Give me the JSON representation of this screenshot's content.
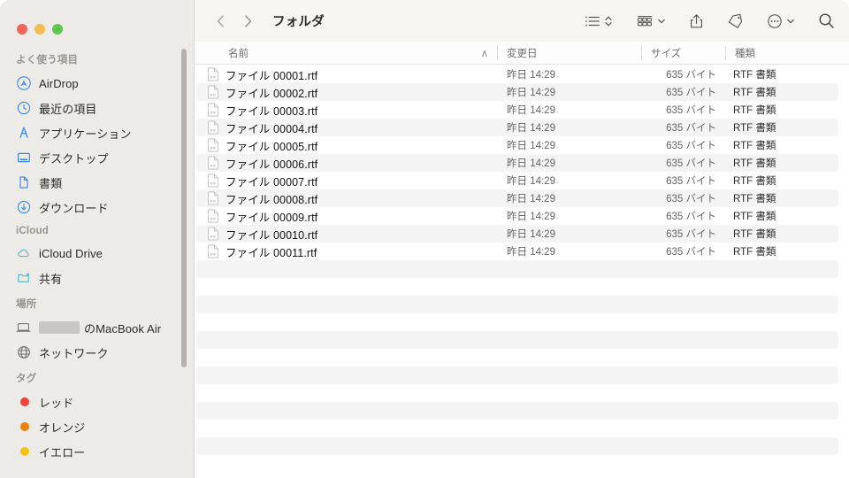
{
  "window": {
    "traffic_lights": [
      {
        "name": "close",
        "color": "#f2655b"
      },
      {
        "name": "minimize",
        "color": "#f4bd4f"
      },
      {
        "name": "maximize",
        "color": "#61c554"
      }
    ]
  },
  "sidebar": {
    "groups": [
      {
        "title": "よく使う項目",
        "items": [
          {
            "icon": "airdrop-icon",
            "label": "AirDrop",
            "color": "#3a86f0"
          },
          {
            "icon": "clock-icon",
            "label": "最近の項目",
            "color": "#3a86f0"
          },
          {
            "icon": "applications-icon",
            "label": "アプリケーション",
            "color": "#3a86f0"
          },
          {
            "icon": "desktop-icon",
            "label": "デスクトップ",
            "color": "#3a86f0"
          },
          {
            "icon": "document-icon",
            "label": "書類",
            "color": "#3a86f0"
          },
          {
            "icon": "downloads-icon",
            "label": "ダウンロード",
            "color": "#3a86f0"
          }
        ]
      },
      {
        "title": "iCloud",
        "items": [
          {
            "icon": "cloud-icon",
            "label": "iCloud Drive",
            "color": "#5ab7c4"
          },
          {
            "icon": "shared-folder-icon",
            "label": "共有",
            "color": "#5ab7c4"
          }
        ]
      },
      {
        "title": "場所",
        "items": [
          {
            "icon": "laptop-icon",
            "label": "のMacBook Air",
            "color": "#6f6f6f",
            "redacted_prefix": true
          },
          {
            "icon": "network-icon",
            "label": "ネットワーク",
            "color": "#6f6f6f"
          }
        ]
      },
      {
        "title": "タグ",
        "items": [
          {
            "icon": "tag-dot-red",
            "label": "レッド",
            "color": "#f6403a"
          },
          {
            "icon": "tag-dot-orange",
            "label": "オレンジ",
            "color": "#f08008"
          },
          {
            "icon": "tag-dot-yellow",
            "label": "イエロー",
            "color": "#f5c211"
          }
        ]
      }
    ]
  },
  "toolbar": {
    "back_label": "戻る",
    "forward_label": "進む",
    "title": "フォルダ",
    "buttons": [
      {
        "name": "view-list-button",
        "label": "表示方法"
      },
      {
        "name": "group-by-button",
        "label": "グループ分け"
      },
      {
        "name": "share-button",
        "label": "共有"
      },
      {
        "name": "tags-button",
        "label": "タグ"
      },
      {
        "name": "more-button",
        "label": "その他"
      },
      {
        "name": "search-button",
        "label": "検索"
      }
    ]
  },
  "file_list": {
    "columns": [
      {
        "key": "name",
        "label": "名前",
        "sorted": true,
        "sort_caret": "∧"
      },
      {
        "key": "date",
        "label": "変更日",
        "sorted": false
      },
      {
        "key": "size",
        "label": "サイズ",
        "sorted": false
      },
      {
        "key": "kind",
        "label": "種類",
        "sorted": false
      }
    ],
    "rows": [
      {
        "name": "ファイル 00001.rtf",
        "date": "昨日 14:29",
        "size": "635 バイト",
        "kind": "RTF 書類"
      },
      {
        "name": "ファイル 00002.rtf",
        "date": "昨日 14:29",
        "size": "635 バイト",
        "kind": "RTF 書類"
      },
      {
        "name": "ファイル 00003.rtf",
        "date": "昨日 14:29",
        "size": "635 バイト",
        "kind": "RTF 書類"
      },
      {
        "name": "ファイル 00004.rtf",
        "date": "昨日 14:29",
        "size": "635 バイト",
        "kind": "RTF 書類"
      },
      {
        "name": "ファイル 00005.rtf",
        "date": "昨日 14:29",
        "size": "635 バイト",
        "kind": "RTF 書類"
      },
      {
        "name": "ファイル 00006.rtf",
        "date": "昨日 14:29",
        "size": "635 バイト",
        "kind": "RTF 書類"
      },
      {
        "name": "ファイル 00007.rtf",
        "date": "昨日 14:29",
        "size": "635 バイト",
        "kind": "RTF 書類"
      },
      {
        "name": "ファイル 00008.rtf",
        "date": "昨日 14:29",
        "size": "635 バイト",
        "kind": "RTF 書類"
      },
      {
        "name": "ファイル 00009.rtf",
        "date": "昨日 14:29",
        "size": "635 バイト",
        "kind": "RTF 書類"
      },
      {
        "name": "ファイル 00010.rtf",
        "date": "昨日 14:29",
        "size": "635 バイト",
        "kind": "RTF 書類"
      },
      {
        "name": "ファイル 00011.rtf",
        "date": "昨日 14:29",
        "size": "635 バイト",
        "kind": "RTF 書類"
      }
    ],
    "empty_row_count": 12
  },
  "colors": {
    "sidebar_bg": "#ecebe7",
    "toolbar_bg": "#f8f5f0",
    "list_bg": "#ffffff",
    "stripe": "#f4f4f4",
    "accent_blue": "#3a86f0"
  }
}
